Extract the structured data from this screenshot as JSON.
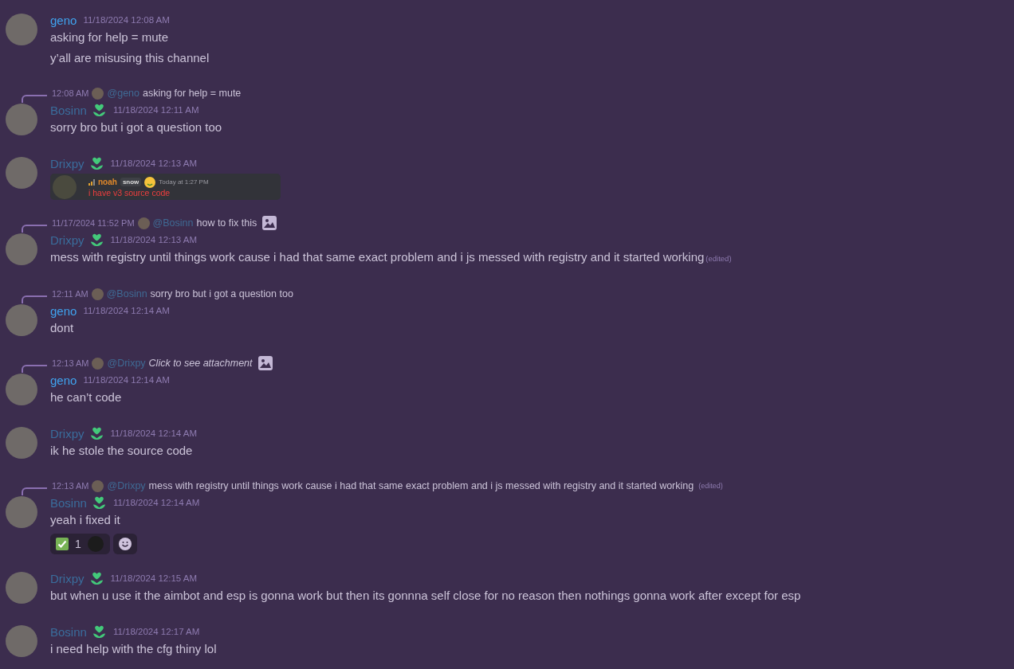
{
  "messages": [
    {
      "author": "geno",
      "color": "#3fa3ef",
      "timestamp": "11/18/2024 12:08 AM",
      "lines": [
        "asking for help = mute",
        "y’all are misusing this channel"
      ]
    },
    {
      "reply": {
        "time": "12:08 AM",
        "mention": "@geno",
        "text": "asking for help = mute"
      },
      "author": "Bosinn",
      "color": "#3a6d9c",
      "badge": true,
      "timestamp": "11/18/2024 12:11 AM",
      "lines": [
        "sorry bro but i got a question too"
      ]
    },
    {
      "author": "Drixpy",
      "color": "#3a6d9c",
      "badge": true,
      "timestamp": "11/18/2024 12:13 AM",
      "forward": {
        "author": "noah",
        "tag": "snow",
        "time": "Today at 1:27 PM",
        "text": "i have v3 source code"
      }
    },
    {
      "reply": {
        "time": "11/17/2024 11:52 PM",
        "mention": "@Bosinn",
        "text": "how to fix this",
        "image": true
      },
      "author": "Drixpy",
      "color": "#3a6d9c",
      "badge": true,
      "timestamp": "11/18/2024 12:13 AM",
      "lines": [
        "mess with registry until things work cause i had that same exact problem and i js messed with registry and it started working"
      ],
      "edited": "(edited)"
    },
    {
      "reply": {
        "time": "12:11 AM",
        "mention": "@Bosinn",
        "text": "sorry bro but i got a question too"
      },
      "author": "geno",
      "color": "#3fa3ef",
      "timestamp": "11/18/2024 12:14 AM",
      "lines": [
        "dont"
      ]
    },
    {
      "reply": {
        "time": "12:13 AM",
        "mention": "@Drixpy",
        "text": "Click to see attachment",
        "italic": true,
        "image": true
      },
      "author": "geno",
      "color": "#3fa3ef",
      "timestamp": "11/18/2024 12:14 AM",
      "lines": [
        "he can’t code"
      ]
    },
    {
      "author": "Drixpy",
      "color": "#3a6d9c",
      "badge": true,
      "timestamp": "11/18/2024 12:14 AM",
      "lines": [
        "ik he stole the source code"
      ]
    },
    {
      "reply": {
        "time": "12:13 AM",
        "mention": "@Drixpy",
        "text": "mess with registry until things work cause i had that same exact problem and i js messed with registry and it started working",
        "edited": "(edited)"
      },
      "author": "Bosinn",
      "color": "#3a6d9c",
      "badge": true,
      "timestamp": "11/18/2024 12:14 AM",
      "lines": [
        "yeah i fixed it"
      ],
      "reactions": [
        {
          "count": "1"
        }
      ]
    },
    {
      "author": "Drixpy",
      "color": "#3a6d9c",
      "badge": true,
      "timestamp": "11/18/2024 12:15 AM",
      "lines": [
        "but when u use it the aimbot and esp is gonna work but then its gonnna self close for no reason then nothings gonna work after except for esp"
      ]
    },
    {
      "author": "Bosinn",
      "color": "#3a6d9c",
      "badge": true,
      "timestamp": "11/18/2024 12:17 AM",
      "lines": [
        "i need help with the cfg thiny lol"
      ]
    }
  ]
}
